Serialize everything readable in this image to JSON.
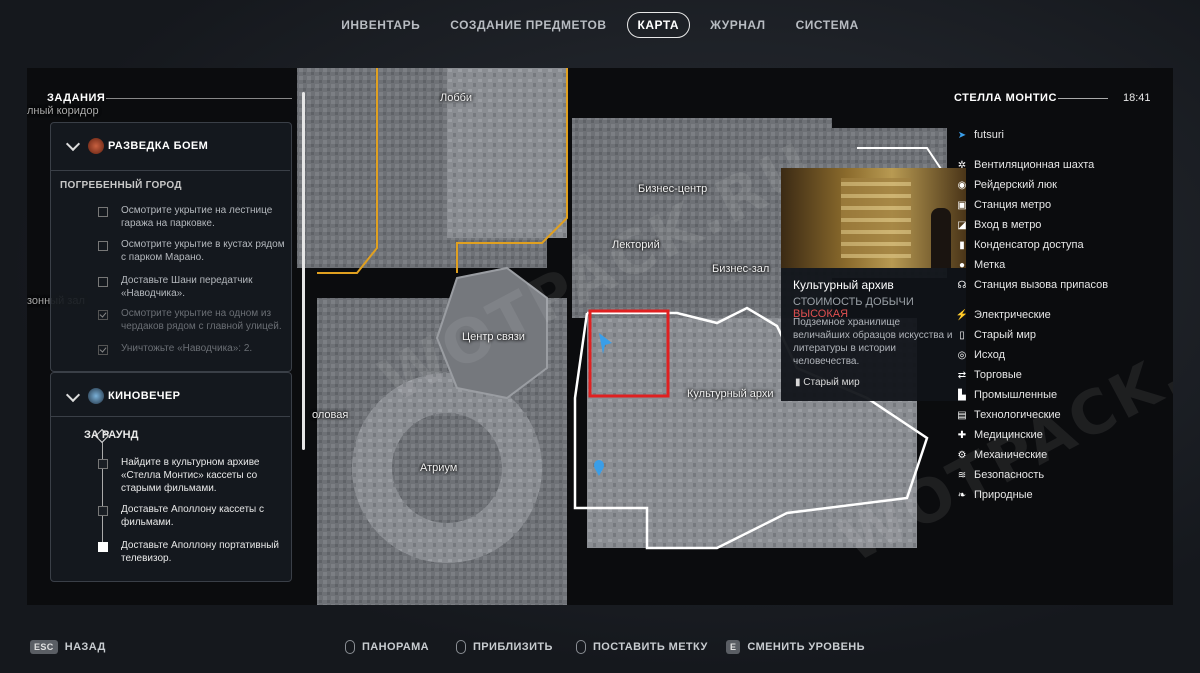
{
  "tabs": [
    {
      "label": "ИНВЕНТАРЬ"
    },
    {
      "label": "СОЗДАНИЕ ПРЕДМЕТОВ"
    },
    {
      "label": "КАРТА"
    },
    {
      "label": "ЖУРНАЛ"
    },
    {
      "label": "СИСТЕМА"
    }
  ],
  "active_tab": "КАРТА",
  "map_labels": {
    "lobby": "Лобби",
    "business_center": "Бизнес-центр",
    "lecture": "Лекторий",
    "business_hall": "Бизнес-зал",
    "comms_center": "Центр связи",
    "cultural_archive": "Культурный архи",
    "atrium": "Атриум",
    "dining": "оловая",
    "corridor": "лный коридор",
    "zone": "зонный зал",
    "badge_2a": "2",
    "badge_2b": "2"
  },
  "quests": {
    "header": "ЗАДАНИЯ",
    "q1": {
      "title": "РАЗВЕДКА БОЕМ",
      "location": "ПОГРЕБЕННЫЙ ГОРОД",
      "tasks": [
        "Осмотрите укрытие на лестнице гаража на парковке.",
        "Осмотрите укрытие в кустах рядом с парком Марано.",
        "Доставьте Шани передатчик «Наводчика».",
        "Осмотрите укрытие на одном из чердаков рядом с главной улицей.",
        "Уничтожьте «Наводчика»: 2."
      ]
    },
    "q2": {
      "title": "КИНОВЕЧЕР",
      "round": "ЗА РАУНД",
      "tasks": [
        "Найдите в культурном архиве «Стелла Монтис» кассеты со старыми фильмами.",
        "Доставьте Аполлону кассеты с фильмами.",
        "Доставьте Аполлону портативный телевизор."
      ]
    }
  },
  "popup": {
    "title": "Культурный архив",
    "cost_label": "СТОИМОСТЬ ДОБЫЧИ",
    "cost_value": "ВЫСОКАЯ",
    "description": "Подземное хранилище величайших образцов искусства и литературы в истории человечества.",
    "tag": "Старый мир"
  },
  "legend": {
    "location": "СТЕЛЛА МОНТИС",
    "time": "18:41",
    "player": "futsuri",
    "items": [
      {
        "icon": "fan-icon",
        "label": "Вентиляционная шахта"
      },
      {
        "icon": "hatch-icon",
        "label": "Рейдерский люк"
      },
      {
        "icon": "metro-station-icon",
        "label": "Станция метро"
      },
      {
        "icon": "metro-entrance-icon",
        "label": "Вход в метро"
      },
      {
        "icon": "condenser-icon",
        "label": "Конденсатор доступа"
      },
      {
        "icon": "marker-icon",
        "label": "Метка"
      },
      {
        "icon": "supply-call-icon",
        "label": "Станция вызова припасов"
      },
      {
        "icon": "electric-icon",
        "label": "Электрические"
      },
      {
        "icon": "old-world-icon",
        "label": "Старый мир"
      },
      {
        "icon": "exodus-icon",
        "label": "Исход"
      },
      {
        "icon": "trade-icon",
        "label": "Торговые"
      },
      {
        "icon": "industrial-icon",
        "label": "Промышленные"
      },
      {
        "icon": "tech-icon",
        "label": "Технологические"
      },
      {
        "icon": "medical-icon",
        "label": "Медицинские"
      },
      {
        "icon": "mechanical-icon",
        "label": "Механические"
      },
      {
        "icon": "security-icon",
        "label": "Безопасность"
      },
      {
        "icon": "nature-icon",
        "label": "Природные"
      }
    ]
  },
  "bottom": {
    "back_key": "ESC",
    "back": "НАЗАД",
    "pan": "ПАНОРАМА",
    "zoom": "ПРИБЛИЗИТЬ",
    "mark": "ПОСТАВИТЬ МЕТКУ",
    "level_key": "E",
    "level": "СМЕНИТЬ УРОВЕНЬ"
  },
  "colors": {
    "highlight_red": "#e02020",
    "yellow_border": "#e0a020",
    "cost_high": "#e05050",
    "player_blue": "#3a9ee8"
  }
}
